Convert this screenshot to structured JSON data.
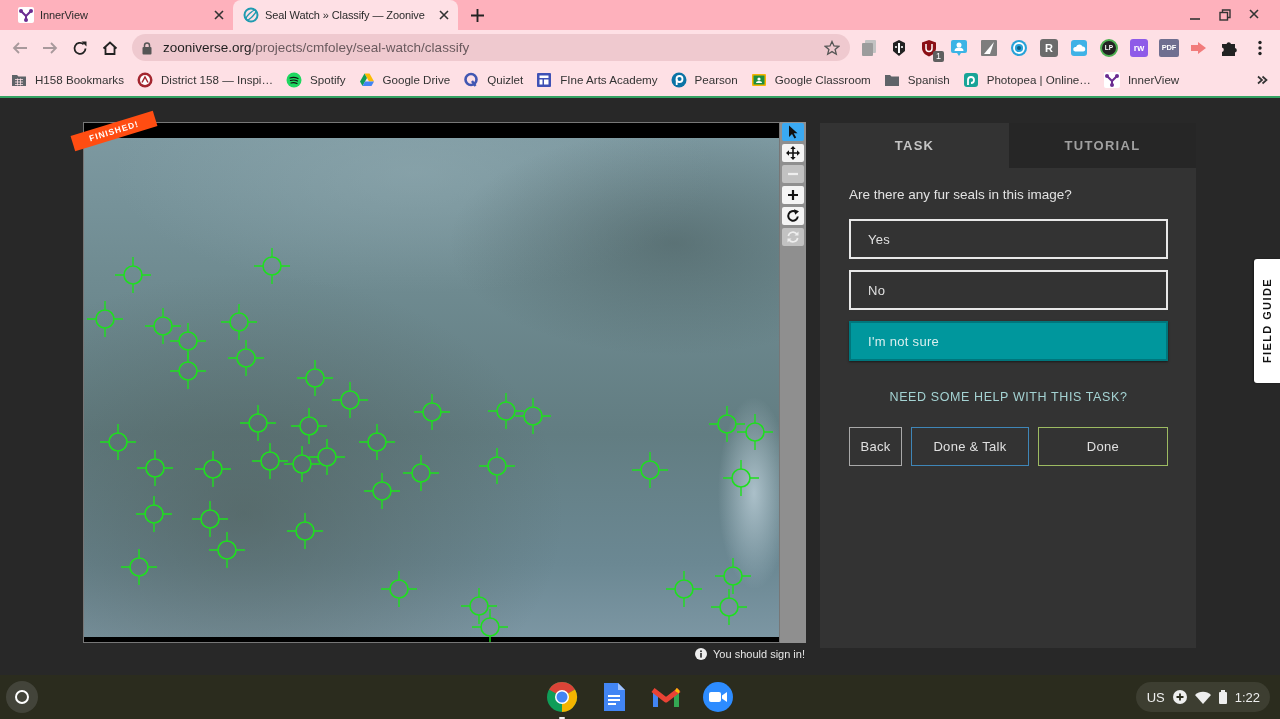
{
  "browser": {
    "tabs": [
      {
        "title": "InnerView",
        "kind": "innerview",
        "selected": false
      },
      {
        "title": "Seal Watch » Classify — Zoonive",
        "kind": "zooniverse",
        "selected": true
      }
    ],
    "nav_buttons": [
      {
        "kind": "back",
        "disabled": true
      },
      {
        "kind": "forward",
        "disabled": true
      },
      {
        "kind": "reload",
        "disabled": false
      },
      {
        "kind": "home",
        "disabled": false
      }
    ],
    "address": {
      "host": "zooniverse.org",
      "path": "/projects/cmfoley/seal-watch/classify"
    },
    "extensions": [
      {
        "kind": "copy"
      },
      {
        "kind": "mask"
      },
      {
        "kind": "shield",
        "badge": "1"
      },
      {
        "kind": "bubble"
      },
      {
        "kind": "triangle"
      },
      {
        "kind": "ring"
      },
      {
        "kind": "tile",
        "glyph": "R"
      },
      {
        "kind": "cloud"
      },
      {
        "kind": "circle",
        "glyph": "LP"
      },
      {
        "kind": "puzzle-tile",
        "glyph": "rw"
      },
      {
        "kind": "doc",
        "glyph": "PDF"
      },
      {
        "kind": "arrow"
      },
      {
        "kind": "extensions"
      }
    ],
    "bookmarks": [
      {
        "label": "H158 Bookmarks",
        "kind": "managed-folder"
      },
      {
        "label": "District 158 — Inspi…",
        "kind": "district"
      },
      {
        "label": "Spotify",
        "kind": "spotify"
      },
      {
        "label": "Google Drive",
        "kind": "drive"
      },
      {
        "label": "Quizlet",
        "kind": "quizlet"
      },
      {
        "label": "FIne Arts Academy",
        "kind": "fine-arts"
      },
      {
        "label": "Pearson",
        "kind": "pearson"
      },
      {
        "label": "Google Classroom",
        "kind": "classroom"
      },
      {
        "label": "Spanish",
        "kind": "folder"
      },
      {
        "label": "Photopea | Online…",
        "kind": "photopea"
      },
      {
        "label": "InnerView",
        "kind": "innerview"
      }
    ]
  },
  "classifier": {
    "ribbon": "FINISHED!",
    "tools": [
      {
        "kind": "pointer",
        "selected": true,
        "disabled": false
      },
      {
        "kind": "move",
        "selected": false,
        "disabled": false
      },
      {
        "kind": "zoom-out",
        "selected": false,
        "disabled": true
      },
      {
        "kind": "zoom-in",
        "selected": false,
        "disabled": false
      },
      {
        "kind": "rotate",
        "selected": false,
        "disabled": false
      },
      {
        "kind": "reset",
        "selected": false,
        "disabled": true
      }
    ],
    "notice": "You should sign in!"
  },
  "task_panel": {
    "tabs": [
      {
        "label": "TASK",
        "selected": true
      },
      {
        "label": "TUTORIAL",
        "selected": false
      }
    ],
    "question": "Are there any fur seals in this image?",
    "answers": [
      {
        "label": "Yes",
        "selected": false
      },
      {
        "label": "No",
        "selected": false
      },
      {
        "label": "I'm not sure",
        "selected": true
      }
    ],
    "help_link": "NEED SOME HELP WITH THIS TASK?",
    "buttons": [
      {
        "label": "Back",
        "kind": "back"
      },
      {
        "label": "Done & Talk",
        "kind": "talk"
      },
      {
        "label": "Done",
        "kind": "done"
      }
    ]
  },
  "field_guide": {
    "label": "FIELD GUIDE"
  },
  "shelf": {
    "apps": [
      {
        "kind": "chrome",
        "running": true
      },
      {
        "kind": "docs",
        "running": false
      },
      {
        "kind": "gmail",
        "running": false
      },
      {
        "kind": "zoom",
        "running": false
      }
    ],
    "tray": {
      "input_method": "US",
      "time": "1:22"
    }
  }
}
